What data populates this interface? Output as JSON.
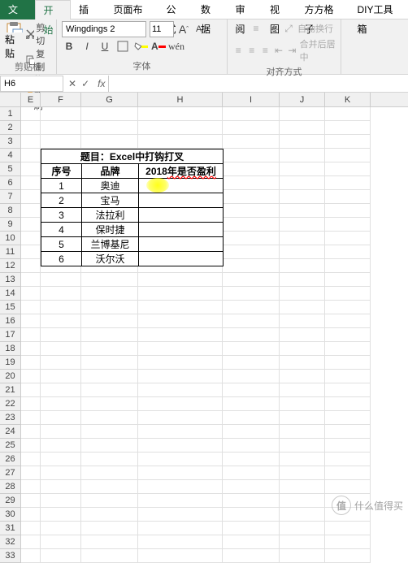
{
  "tabs": {
    "file": "文件",
    "home": "开始",
    "insert": "插入",
    "layout": "页面布局",
    "formulas": "公式",
    "data": "数据",
    "review": "审阅",
    "view": "视图",
    "fanggezi": "方方格子",
    "diy": "DIY工具箱"
  },
  "clipboard": {
    "paste": "粘贴",
    "cut": "剪切",
    "copy": "复制",
    "format_painter": "格式刷",
    "label": "剪贴板"
  },
  "font": {
    "name": "Wingdings 2",
    "size": "11",
    "inc_label": "A",
    "dec_label": "A",
    "bold": "B",
    "italic": "I",
    "underline": "U",
    "label": "字体"
  },
  "align": {
    "wrap": "自动换行",
    "merge": "合并后居中",
    "label": "对齐方式"
  },
  "namebox": "H6",
  "formula": "",
  "columns": [
    "E",
    "F",
    "G",
    "H",
    "I",
    "J",
    "K"
  ],
  "rows": [
    "1",
    "2",
    "3",
    "4",
    "5",
    "6",
    "7",
    "8",
    "9",
    "10",
    "11",
    "12",
    "13",
    "14",
    "15",
    "16",
    "17",
    "18",
    "19",
    "20",
    "21",
    "22",
    "23",
    "24",
    "25",
    "26",
    "27",
    "28",
    "29",
    "30",
    "31",
    "32",
    "33"
  ],
  "table": {
    "title": "题目：Excel中打钩打叉",
    "headers": {
      "col1": "序号",
      "col2": "品牌",
      "col3_a": "2018",
      "col3_b": "年是否盈利"
    },
    "data": [
      {
        "no": "1",
        "brand": "奥迪",
        "profit": ""
      },
      {
        "no": "2",
        "brand": "宝马",
        "profit": ""
      },
      {
        "no": "3",
        "brand": "法拉利",
        "profit": ""
      },
      {
        "no": "4",
        "brand": "保时捷",
        "profit": ""
      },
      {
        "no": "5",
        "brand": "兰博基尼",
        "profit": ""
      },
      {
        "no": "6",
        "brand": "沃尔沃",
        "profit": ""
      }
    ]
  },
  "watermark": {
    "icon": "值",
    "text": "什么值得买"
  }
}
